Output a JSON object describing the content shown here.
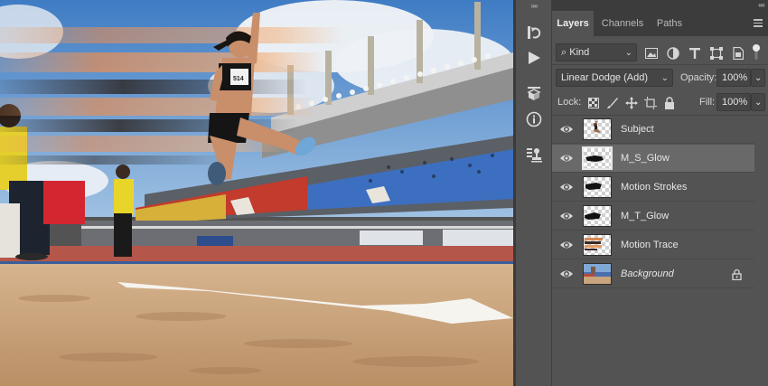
{
  "canvas": {
    "description_icon": "photo-long-jump-athlete",
    "bib_number": "514"
  },
  "toolstrip": {
    "collapse_glyph": "»»",
    "tools": [
      {
        "icon": "history-icon"
      },
      {
        "icon": "play-actions-icon"
      },
      {
        "icon": "3d-cube-icon"
      },
      {
        "icon": "info-icon"
      },
      {
        "icon": "clone-source-icon"
      }
    ]
  },
  "panel": {
    "collapse_glyph": "««",
    "tabs": [
      {
        "label": "Layers",
        "active": true
      },
      {
        "label": "Channels",
        "active": false
      },
      {
        "label": "Paths",
        "active": false
      }
    ],
    "filter": {
      "glyph": "⌕",
      "value": "Kind"
    },
    "blend_mode": "Linear Dodge (Add)",
    "opacity_label": "Opacity:",
    "opacity_value": "100%",
    "lock_label": "Lock:",
    "fill_label": "Fill:",
    "fill_value": "100%",
    "dropdown_arrow": "⌄",
    "layers": [
      {
        "name": "Subject",
        "selected": false,
        "italic": false,
        "thumb": "subject"
      },
      {
        "name": "M_S_Glow",
        "selected": true,
        "italic": false,
        "thumb": "glow"
      },
      {
        "name": "Motion Strokes",
        "selected": false,
        "italic": false,
        "thumb": "strokes"
      },
      {
        "name": "M_T_Glow",
        "selected": false,
        "italic": false,
        "thumb": "glow"
      },
      {
        "name": "Motion Trace",
        "selected": false,
        "italic": false,
        "thumb": "trace"
      },
      {
        "name": "Background",
        "selected": false,
        "italic": true,
        "thumb": "background",
        "locked": true
      }
    ]
  },
  "colors": {
    "panel_bg": "#535353",
    "tab_bar": "#3c3c3c",
    "selected_row": "#696969",
    "sky": "#4d87c7",
    "sand": "#c8a47c",
    "track": "#b4574a",
    "seats_blue": "#3d6fc0",
    "seats_red": "#c23b2c"
  }
}
